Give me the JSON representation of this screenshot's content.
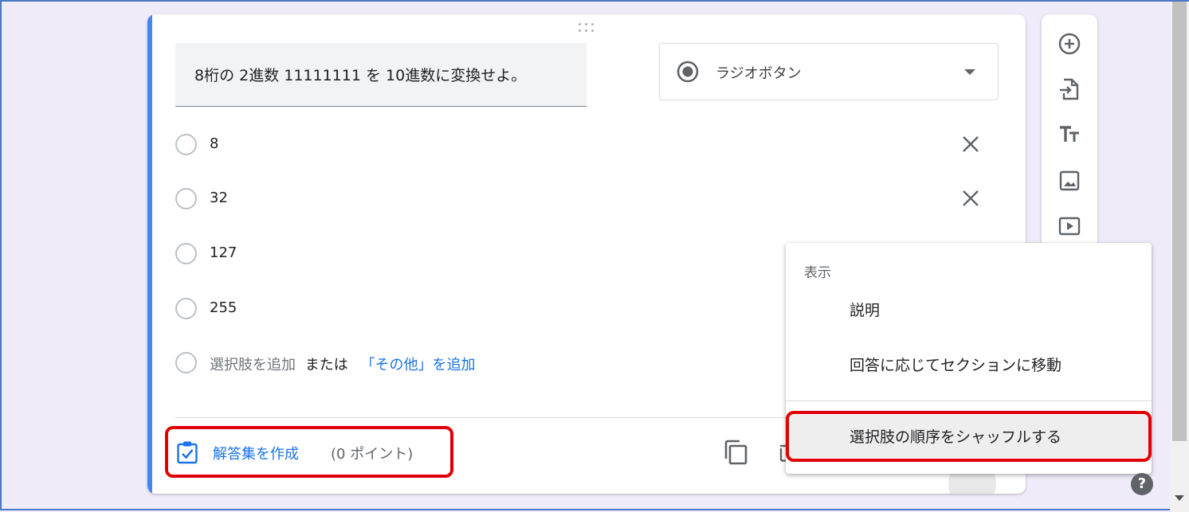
{
  "question": {
    "text": "8桁の 2進数 11111111 を 10進数に変換せよ。",
    "type_label": "ラジオボタン",
    "type_icon": "radio-button-icon"
  },
  "options": [
    {
      "label": "8"
    },
    {
      "label": "32"
    },
    {
      "label": "127"
    },
    {
      "label": "255"
    }
  ],
  "add_option": {
    "label": "選択肢を追加",
    "or": "または",
    "other_link": "「その他」を追加"
  },
  "footer": {
    "answer_key_label": "解答集を作成",
    "points": "(0 ポイント)"
  },
  "context_menu": {
    "section_label": "表示",
    "items": [
      "説明",
      "回答に応じてセクションに移動",
      "選択肢の順序をシャッフルする"
    ]
  },
  "side_toolbar": [
    "add-question-icon",
    "import-questions-icon",
    "add-title-icon",
    "add-image-icon",
    "add-video-icon"
  ],
  "colors": {
    "accent": "#4285f4",
    "link": "#1a73e8",
    "highlight_border": "#e00000",
    "background": "#f0ebf8"
  },
  "help": "?"
}
